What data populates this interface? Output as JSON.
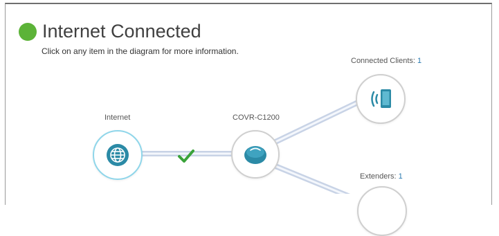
{
  "status": {
    "title": "Internet Connected",
    "subtitle": "Click on any item in the diagram for more information.",
    "dot_color": "#5cb338",
    "check_color": "#3aa33a"
  },
  "nodes": {
    "internet": {
      "label": "Internet",
      "icon": "globe-icon"
    },
    "router": {
      "label": "COVR-C1200",
      "icon": "router-icon"
    },
    "clients": {
      "label": "Connected Clients:",
      "count": "1",
      "icon": "wireless-device-icon"
    },
    "extenders": {
      "label": "Extenders:",
      "count": "1",
      "icon": "extender-icon"
    }
  },
  "accent_color": "#2b8aa6"
}
